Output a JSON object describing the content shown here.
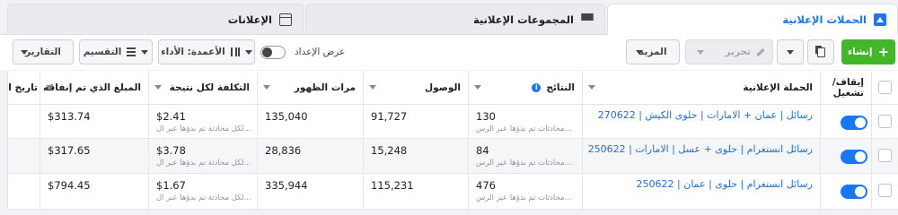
{
  "tabs": [
    {
      "label": "الحملات الإعلانية",
      "icon": "campaign-icon"
    },
    {
      "label": "المجموعات الإعلانية",
      "icon": "adsets-grid-icon"
    },
    {
      "label": "الإعلانات",
      "icon": "ads-panel-icon"
    }
  ],
  "toolbar": {
    "create": "إنشاء",
    "edit": "تحرير",
    "more": "المزيد",
    "view_setup": "عرض الإعداد",
    "columns": "الأعمدة: الأداء",
    "breakdown": "التقسيم",
    "reports": "التقارير"
  },
  "table": {
    "headers": {
      "toggle": "إيقاف/ تشغيل",
      "campaign": "الحملة الإعلانية",
      "results": "النتائج",
      "reach": "الوصول",
      "impressions": "مرات الظهور",
      "cost_per_result": "التكلفة لكل نتيجة",
      "amount_spent": "المبلغ الذي تم إنفاقه",
      "end_date": "تاريخ ال"
    },
    "rows": [
      {
        "campaign": "رسائل | عمان + الامارات | حلوى الكيش | 270622",
        "results": "130",
        "results_sub": "محادثات تم بدؤها عبر الرس...",
        "reach": "91,727",
        "impressions": "135,040",
        "cost": "$2.41",
        "cost_sub": "لكل محادثة تم بدؤها عبر ال...",
        "spent": "$313.74"
      },
      {
        "campaign": "رسائل انستغرام | حلوى + عسل | الامارات | 250622",
        "results": "84",
        "results_sub": "محادثات تم بدؤها عبر الرس...",
        "reach": "15,248",
        "impressions": "28,836",
        "cost": "$3.78",
        "cost_sub": "لكل محادثة تم بدؤها عبر ال...",
        "spent": "$317.65"
      },
      {
        "campaign": "رسائل انستغرام | حلوى | عمان | 250622",
        "results": "476",
        "results_sub": "محادثات تم بدؤها عبر الرس...",
        "reach": "115,231",
        "impressions": "335,944",
        "cost": "$1.67",
        "cost_sub": "لكل محادثة تم بدؤها عبر ال...",
        "spent": "$794.45"
      }
    ]
  },
  "colors": {
    "accent": "#1877f2",
    "create": "#42b72a",
    "link": "#216fdb"
  }
}
